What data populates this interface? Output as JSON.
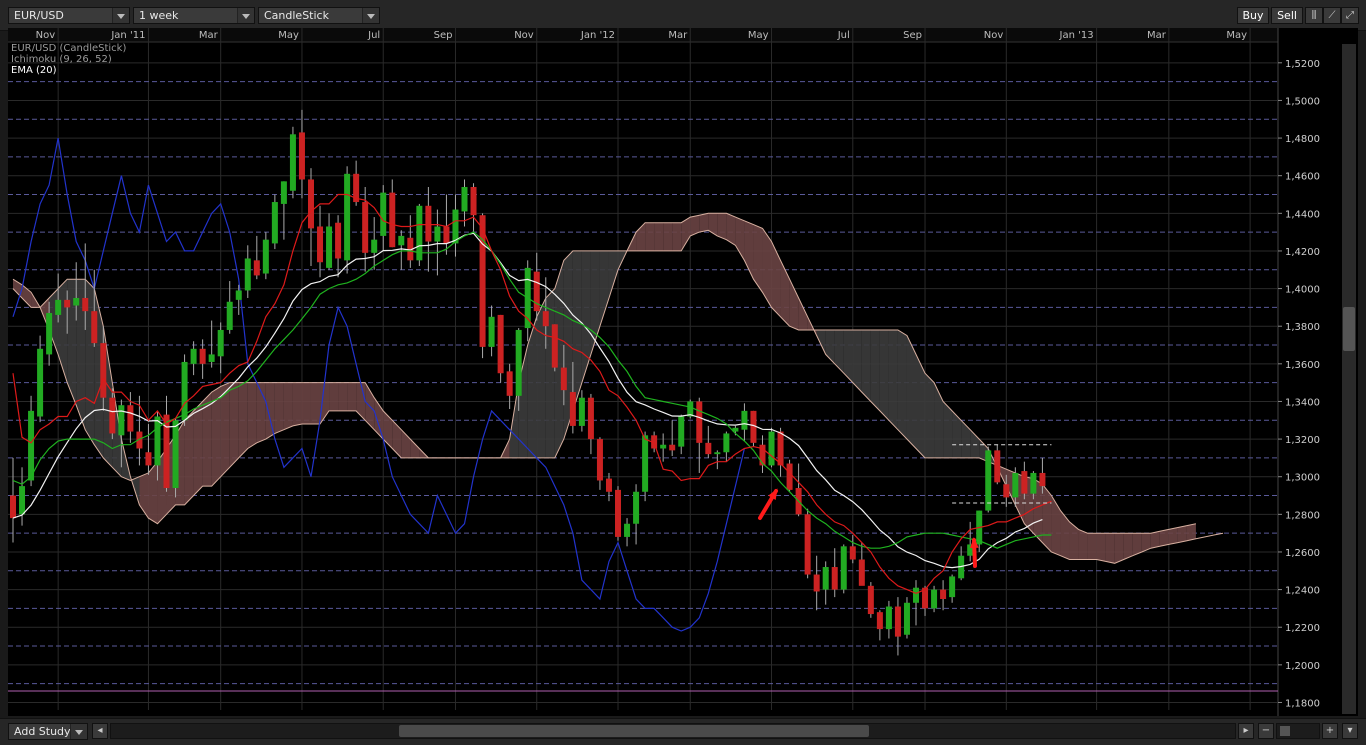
{
  "toolbar": {
    "symbol": "EUR/USD",
    "interval": "1 week",
    "chart_type": "CandleStick",
    "buy_label": "Buy",
    "sell_label": "Sell"
  },
  "bottom": {
    "add_study_label": "Add Study",
    "minus_label": "−",
    "plus_label": "+"
  },
  "chart_data": {
    "type": "candlestick",
    "legend": [
      "EUR/USD (CandleStick)",
      "Ichimoku (9, 26, 52)",
      "EMA (20)"
    ],
    "time_labels": [
      "Nov",
      "Jan '11",
      "Mar",
      "May",
      "Jul",
      "Sep",
      "Nov",
      "Jan '12",
      "Mar",
      "May",
      "Jul",
      "Sep",
      "Nov",
      "Jan '13",
      "Mar",
      "May"
    ],
    "price_ticks": [
      "1,5200",
      "1,5000",
      "1,4800",
      "1,4600",
      "1,4400",
      "1,4200",
      "1,4000",
      "1,3800",
      "1,3600",
      "1,3400",
      "1,3200",
      "1,3000",
      "1,2800",
      "1,2600",
      "1,2400",
      "1,2200",
      "1,2000",
      "1,1800"
    ],
    "ylim": [
      1.176,
      1.53
    ],
    "x_range": [
      0,
      137
    ],
    "month_weeks": [
      5,
      15,
      23,
      32,
      41,
      49,
      58,
      67,
      75,
      84,
      93,
      101,
      110,
      120,
      128,
      137
    ],
    "candles": [
      [
        1.29,
        1.31,
        1.265,
        1.278
      ],
      [
        1.28,
        1.305,
        1.274,
        1.295
      ],
      [
        1.298,
        1.343,
        1.295,
        1.335
      ],
      [
        1.332,
        1.375,
        1.329,
        1.368
      ],
      [
        1.365,
        1.393,
        1.359,
        1.387
      ],
      [
        1.386,
        1.408,
        1.382,
        1.394
      ],
      [
        1.394,
        1.399,
        1.376,
        1.39
      ],
      [
        1.391,
        1.414,
        1.383,
        1.395
      ],
      [
        1.395,
        1.424,
        1.378,
        1.388
      ],
      [
        1.388,
        1.41,
        1.369,
        1.371
      ],
      [
        1.371,
        1.38,
        1.335,
        1.342
      ],
      [
        1.342,
        1.347,
        1.32,
        1.323
      ],
      [
        1.322,
        1.341,
        1.305,
        1.338
      ],
      [
        1.338,
        1.345,
        1.318,
        1.324
      ],
      [
        1.324,
        1.343,
        1.306,
        1.315
      ],
      [
        1.313,
        1.328,
        1.301,
        1.306
      ],
      [
        1.306,
        1.335,
        1.298,
        1.332
      ],
      [
        1.333,
        1.343,
        1.292,
        1.294
      ],
      [
        1.294,
        1.331,
        1.289,
        1.33
      ],
      [
        1.33,
        1.365,
        1.327,
        1.361
      ],
      [
        1.36,
        1.372,
        1.354,
        1.368
      ],
      [
        1.368,
        1.373,
        1.352,
        1.36
      ],
      [
        1.361,
        1.383,
        1.358,
        1.365
      ],
      [
        1.364,
        1.382,
        1.355,
        1.378
      ],
      [
        1.378,
        1.404,
        1.376,
        1.393
      ],
      [
        1.394,
        1.402,
        1.386,
        1.399
      ],
      [
        1.399,
        1.423,
        1.395,
        1.416
      ],
      [
        1.415,
        1.428,
        1.405,
        1.407
      ],
      [
        1.408,
        1.43,
        1.405,
        1.426
      ],
      [
        1.424,
        1.45,
        1.421,
        1.446
      ],
      [
        1.445,
        1.457,
        1.426,
        1.457
      ],
      [
        1.452,
        1.486,
        1.448,
        1.482
      ],
      [
        1.483,
        1.495,
        1.448,
        1.458
      ],
      [
        1.458,
        1.464,
        1.412,
        1.432
      ],
      [
        1.433,
        1.444,
        1.406,
        1.414
      ],
      [
        1.411,
        1.44,
        1.41,
        1.433
      ],
      [
        1.435,
        1.439,
        1.406,
        1.416
      ],
      [
        1.415,
        1.465,
        1.408,
        1.461
      ],
      [
        1.461,
        1.468,
        1.444,
        1.446
      ],
      [
        1.446,
        1.454,
        1.409,
        1.419
      ],
      [
        1.419,
        1.438,
        1.41,
        1.426
      ],
      [
        1.428,
        1.455,
        1.42,
        1.451
      ],
      [
        1.451,
        1.458,
        1.422,
        1.422
      ],
      [
        1.423,
        1.431,
        1.41,
        1.428
      ],
      [
        1.427,
        1.439,
        1.411,
        1.415
      ],
      [
        1.415,
        1.445,
        1.412,
        1.444
      ],
      [
        1.444,
        1.454,
        1.409,
        1.425
      ],
      [
        1.425,
        1.442,
        1.407,
        1.433
      ],
      [
        1.433,
        1.45,
        1.418,
        1.424
      ],
      [
        1.424,
        1.45,
        1.417,
        1.442
      ],
      [
        1.441,
        1.458,
        1.433,
        1.454
      ],
      [
        1.454,
        1.456,
        1.43,
        1.439
      ],
      [
        1.439,
        1.44,
        1.363,
        1.369
      ],
      [
        1.369,
        1.391,
        1.364,
        1.385
      ],
      [
        1.386,
        1.386,
        1.35,
        1.355
      ],
      [
        1.356,
        1.36,
        1.336,
        1.343
      ],
      [
        1.343,
        1.379,
        1.335,
        1.378
      ],
      [
        1.379,
        1.415,
        1.372,
        1.411
      ],
      [
        1.409,
        1.419,
        1.383,
        1.388
      ],
      [
        1.388,
        1.406,
        1.368,
        1.38
      ],
      [
        1.381,
        1.381,
        1.356,
        1.358
      ],
      [
        1.358,
        1.37,
        1.338,
        1.346
      ],
      [
        1.345,
        1.361,
        1.323,
        1.327
      ],
      [
        1.327,
        1.346,
        1.324,
        1.342
      ],
      [
        1.342,
        1.344,
        1.312,
        1.32
      ],
      [
        1.32,
        1.321,
        1.293,
        1.298
      ],
      [
        1.299,
        1.302,
        1.287,
        1.292
      ],
      [
        1.293,
        1.295,
        1.266,
        1.268
      ],
      [
        1.268,
        1.278,
        1.263,
        1.275
      ],
      [
        1.275,
        1.296,
        1.264,
        1.292
      ],
      [
        1.292,
        1.324,
        1.287,
        1.322
      ],
      [
        1.322,
        1.324,
        1.313,
        1.315
      ],
      [
        1.315,
        1.323,
        1.308,
        1.317
      ],
      [
        1.317,
        1.33,
        1.311,
        1.314
      ],
      [
        1.316,
        1.333,
        1.312,
        1.332
      ],
      [
        1.332,
        1.341,
        1.331,
        1.34
      ],
      [
        1.34,
        1.342,
        1.302,
        1.318
      ],
      [
        1.318,
        1.327,
        1.31,
        1.312
      ],
      [
        1.312,
        1.314,
        1.304,
        1.313
      ],
      [
        1.313,
        1.324,
        1.308,
        1.323
      ],
      [
        1.324,
        1.327,
        1.322,
        1.326
      ],
      [
        1.325,
        1.339,
        1.319,
        1.335
      ],
      [
        1.335,
        1.335,
        1.316,
        1.318
      ],
      [
        1.317,
        1.322,
        1.302,
        1.306
      ],
      [
        1.306,
        1.326,
        1.305,
        1.324
      ],
      [
        1.324,
        1.326,
        1.3,
        1.306
      ],
      [
        1.307,
        1.309,
        1.292,
        1.293
      ],
      [
        1.294,
        1.307,
        1.279,
        1.28
      ],
      [
        1.28,
        1.283,
        1.246,
        1.248
      ],
      [
        1.248,
        1.258,
        1.229,
        1.239
      ],
      [
        1.24,
        1.255,
        1.232,
        1.252
      ],
      [
        1.252,
        1.262,
        1.236,
        1.24
      ],
      [
        1.24,
        1.264,
        1.238,
        1.263
      ],
      [
        1.263,
        1.269,
        1.254,
        1.256
      ],
      [
        1.256,
        1.265,
        1.243,
        1.242
      ],
      [
        1.242,
        1.244,
        1.225,
        1.227
      ],
      [
        1.228,
        1.229,
        1.213,
        1.219
      ],
      [
        1.219,
        1.234,
        1.214,
        1.231
      ],
      [
        1.231,
        1.236,
        1.205,
        1.215
      ],
      [
        1.216,
        1.236,
        1.214,
        1.233
      ],
      [
        1.233,
        1.245,
        1.221,
        1.241
      ],
      [
        1.241,
        1.242,
        1.226,
        1.23
      ],
      [
        1.23,
        1.242,
        1.228,
        1.24
      ],
      [
        1.24,
        1.245,
        1.229,
        1.235
      ],
      [
        1.236,
        1.248,
        1.233,
        1.247
      ],
      [
        1.246,
        1.263,
        1.245,
        1.258
      ],
      [
        1.258,
        1.276,
        1.255,
        1.264
      ],
      [
        1.264,
        1.282,
        1.26,
        1.282
      ],
      [
        1.282,
        1.316,
        1.281,
        1.314
      ],
      [
        1.314,
        1.317,
        1.296,
        1.297
      ],
      [
        1.296,
        1.301,
        1.284,
        1.289
      ],
      [
        1.289,
        1.305,
        1.284,
        1.302
      ],
      [
        1.303,
        1.308,
        1.288,
        1.291
      ],
      [
        1.291,
        1.303,
        1.288,
        1.302
      ],
      [
        1.302,
        1.31,
        1.291,
        1.295
      ]
    ],
    "tenkan_sen": [
      1.355,
      1.321,
      1.318,
      1.325,
      1.328,
      1.332,
      1.332,
      1.34,
      1.342,
      1.339,
      1.352,
      1.345,
      1.345,
      1.34,
      1.338,
      1.33,
      1.335,
      1.328,
      1.331,
      1.339,
      1.343,
      1.348,
      1.349,
      1.35,
      1.355,
      1.359,
      1.361,
      1.372,
      1.385,
      1.392,
      1.402,
      1.42,
      1.435,
      1.441,
      1.445,
      1.445,
      1.45,
      1.45,
      1.448,
      1.447,
      1.443,
      1.436,
      1.434,
      1.433,
      1.433,
      1.434,
      1.434,
      1.434,
      1.433,
      1.436,
      1.436,
      1.438,
      1.432,
      1.42,
      1.41,
      1.396,
      1.388,
      1.384,
      1.378,
      1.375,
      1.374,
      1.372,
      1.368,
      1.366,
      1.362,
      1.356,
      1.346,
      1.343,
      1.337,
      1.33,
      1.32,
      1.318,
      1.304,
      1.303,
      1.298,
      1.299,
      1.299,
      1.306,
      1.308,
      1.308,
      1.312,
      1.315,
      1.316,
      1.315,
      1.311,
      1.307,
      1.302,
      1.297,
      1.292,
      1.285,
      1.28,
      1.276,
      1.274,
      1.27,
      1.265,
      1.26,
      1.252,
      1.246,
      1.242,
      1.24,
      1.238,
      1.24,
      1.246,
      1.25,
      1.26,
      1.267,
      1.272,
      1.273,
      1.274,
      1.276,
      1.276,
      1.278,
      1.28,
      1.283,
      1.285,
      1.287
    ],
    "kijun_sen": [
      1.298,
      1.296,
      1.3,
      1.309,
      1.315,
      1.319,
      1.32,
      1.32,
      1.32,
      1.32,
      1.318,
      1.315,
      1.317,
      1.317,
      1.32,
      1.322,
      1.326,
      1.329,
      1.331,
      1.333,
      1.336,
      1.338,
      1.34,
      1.342,
      1.346,
      1.348,
      1.351,
      1.356,
      1.362,
      1.368,
      1.373,
      1.378,
      1.384,
      1.39,
      1.397,
      1.4,
      1.402,
      1.403,
      1.405,
      1.408,
      1.412,
      1.415,
      1.418,
      1.42,
      1.42,
      1.419,
      1.419,
      1.419,
      1.421,
      1.425,
      1.428,
      1.43,
      1.426,
      1.42,
      1.413,
      1.405,
      1.398,
      1.395,
      1.392,
      1.39,
      1.388,
      1.386,
      1.383,
      1.381,
      1.378,
      1.374,
      1.369,
      1.362,
      1.356,
      1.348,
      1.342,
      1.341,
      1.34,
      1.339,
      1.338,
      1.337,
      1.335,
      1.333,
      1.331,
      1.328,
      1.323,
      1.319,
      1.314,
      1.307,
      1.303,
      1.297,
      1.292,
      1.287,
      1.282,
      1.278,
      1.275,
      1.271,
      1.268,
      1.265,
      1.263,
      1.262,
      1.262,
      1.263,
      1.265,
      1.268,
      1.269,
      1.27,
      1.27,
      1.27,
      1.269,
      1.268,
      1.267,
      1.266,
      1.264,
      1.262,
      1.264,
      1.266,
      1.267,
      1.268,
      1.269,
      1.269
    ],
    "chikou_span": [
      1.385,
      1.4,
      1.425,
      1.445,
      1.455,
      1.48,
      1.45,
      1.425,
      1.415,
      1.4,
      1.42,
      1.44,
      1.46,
      1.44,
      1.43,
      1.455,
      1.44,
      1.425,
      1.43,
      1.42,
      1.42,
      1.43,
      1.44,
      1.445,
      1.43,
      1.405,
      1.36,
      1.35,
      1.34,
      1.32,
      1.305,
      1.31,
      1.315,
      1.3,
      1.33,
      1.37,
      1.39,
      1.38,
      1.36,
      1.34,
      1.335,
      1.32,
      1.3,
      1.29,
      1.28,
      1.275,
      1.27,
      1.29,
      1.28,
      1.27,
      1.275,
      1.3,
      1.32,
      1.335,
      1.33,
      1.325,
      1.32,
      1.315,
      1.31,
      1.305,
      1.295,
      1.285,
      1.27,
      1.245,
      1.24,
      1.235,
      1.255,
      1.265,
      1.25,
      1.235,
      1.23,
      1.23,
      1.225,
      1.22,
      1.218,
      1.22,
      1.225,
      1.238,
      1.255,
      1.275,
      1.295,
      1.315
    ],
    "senkou_a": [
      1.405,
      1.402,
      1.398,
      1.39,
      1.378,
      1.365,
      1.35,
      1.338,
      1.325,
      1.317,
      1.31,
      1.305,
      1.3,
      1.298,
      1.3,
      1.302,
      1.308,
      1.315,
      1.322,
      1.33,
      1.335,
      1.34,
      1.345,
      1.348,
      1.35,
      1.35,
      1.35,
      1.35,
      1.35,
      1.35,
      1.35,
      1.35,
      1.35,
      1.35,
      1.35,
      1.35,
      1.35,
      1.35,
      1.35,
      1.35,
      1.342,
      1.335,
      1.33,
      1.325,
      1.32,
      1.315,
      1.31,
      1.31,
      1.31,
      1.31,
      1.31,
      1.31,
      1.31,
      1.31,
      1.31,
      1.31,
      1.31,
      1.31,
      1.31,
      1.31,
      1.31,
      1.32,
      1.335,
      1.35,
      1.365,
      1.38,
      1.395,
      1.41,
      1.42,
      1.43,
      1.435,
      1.435,
      1.435,
      1.435,
      1.435,
      1.438,
      1.439,
      1.44,
      1.44,
      1.44,
      1.438,
      1.436,
      1.434,
      1.432,
      1.425,
      1.415,
      1.405,
      1.395,
      1.385,
      1.375,
      1.365,
      1.36,
      1.355,
      1.35,
      1.345,
      1.34,
      1.335,
      1.33,
      1.325,
      1.32,
      1.315,
      1.31,
      1.31,
      1.31,
      1.31,
      1.31,
      1.31,
      1.31,
      1.308,
      1.306,
      1.304,
      1.302,
      1.3,
      1.299,
      1.296,
      1.29,
      1.282,
      1.276,
      1.272,
      1.27,
      1.27,
      1.27,
      1.27,
      1.27,
      1.27,
      1.27,
      1.27,
      1.271,
      1.272,
      1.273,
      1.274,
      1.275
    ],
    "senkou_b": [
      1.4,
      1.395,
      1.39,
      1.39,
      1.395,
      1.4,
      1.405,
      1.405,
      1.405,
      1.4,
      1.38,
      1.35,
      1.32,
      1.3,
      1.285,
      1.278,
      1.275,
      1.28,
      1.285,
      1.285,
      1.29,
      1.295,
      1.295,
      1.3,
      1.305,
      1.31,
      1.315,
      1.318,
      1.32,
      1.323,
      1.325,
      1.327,
      1.328,
      1.328,
      1.328,
      1.335,
      1.335,
      1.335,
      1.335,
      1.33,
      1.325,
      1.32,
      1.315,
      1.31,
      1.31,
      1.31,
      1.31,
      1.31,
      1.31,
      1.31,
      1.31,
      1.31,
      1.31,
      1.31,
      1.31,
      1.32,
      1.35,
      1.37,
      1.385,
      1.395,
      1.4,
      1.415,
      1.42,
      1.42,
      1.42,
      1.42,
      1.42,
      1.42,
      1.42,
      1.42,
      1.42,
      1.42,
      1.42,
      1.42,
      1.42,
      1.428,
      1.43,
      1.431,
      1.428,
      1.426,
      1.423,
      1.415,
      1.405,
      1.398,
      1.39,
      1.385,
      1.38,
      1.378,
      1.378,
      1.378,
      1.378,
      1.378,
      1.378,
      1.378,
      1.378,
      1.378,
      1.378,
      1.378,
      1.378,
      1.375,
      1.365,
      1.355,
      1.35,
      1.34,
      1.335,
      1.33,
      1.325,
      1.32,
      1.315,
      1.305,
      1.295,
      1.285,
      1.275,
      1.27,
      1.265,
      1.26,
      1.258,
      1.256,
      1.256,
      1.256,
      1.256,
      1.255,
      1.254,
      1.256,
      1.258,
      1.26,
      1.262,
      1.263,
      1.264,
      1.265,
      1.266,
      1.267,
      1.268,
      1.269,
      1.27
    ]
  },
  "colors": {
    "bull": "#22aa22",
    "bear": "#cc2222",
    "tenkan": "#dd1a1a",
    "kijun": "#1fb21f",
    "chikou": "#2233cc",
    "ema": "#f2f2f2",
    "cloud_bull": "#6a4444",
    "cloud_bear": "#3c3c3c",
    "annotation_arrow": "#ff1a1a"
  }
}
